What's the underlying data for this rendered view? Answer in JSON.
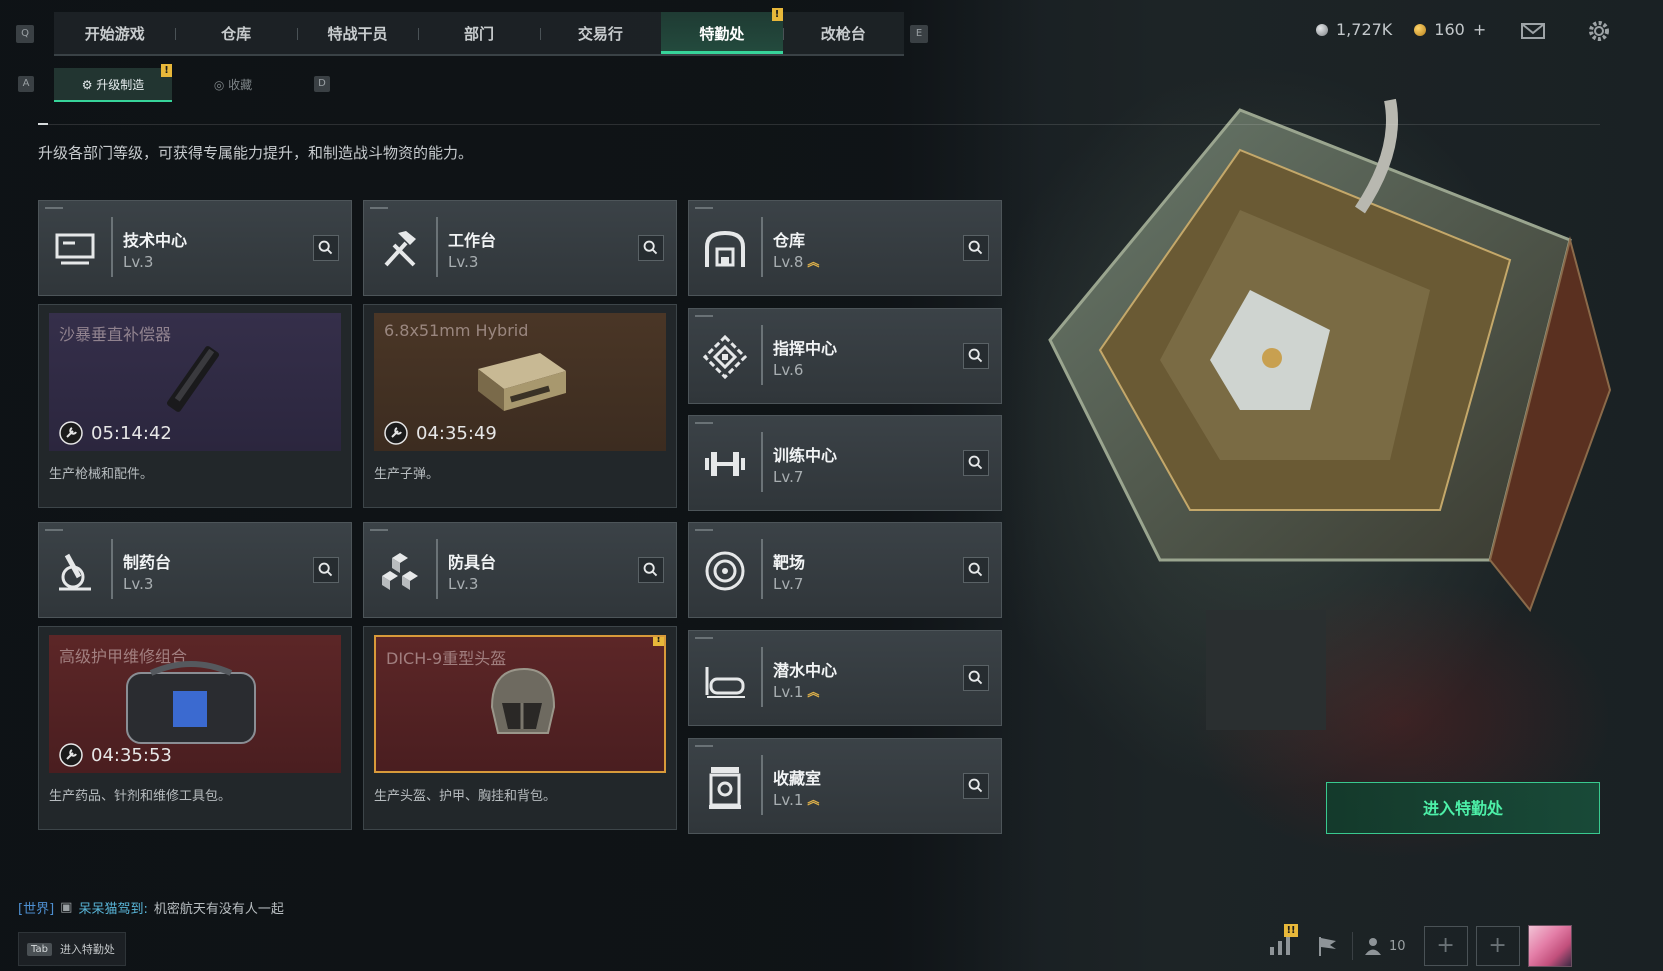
{
  "header": {
    "tabs": [
      {
        "label": "开始游戏"
      },
      {
        "label": "仓库"
      },
      {
        "label": "特战干员"
      },
      {
        "label": "部门"
      },
      {
        "label": "交易行"
      },
      {
        "label": "特勤处",
        "active": true,
        "alert": "!"
      },
      {
        "label": "改枪台"
      }
    ],
    "left_key": "Q",
    "right_key": "E",
    "currency": {
      "silver": "1,727K",
      "gold": "160",
      "add": "+"
    },
    "icons": [
      "mail-icon",
      "gear-icon"
    ]
  },
  "subtabs": {
    "left_key": "A",
    "right_key": "D",
    "items": [
      {
        "label": "升级制造",
        "active": true,
        "alert": "!"
      },
      {
        "label": "收藏",
        "active": false
      }
    ]
  },
  "description": "升级各部门等级，可获得专属能力提升，和制造战斗物资的能力。",
  "departments": [
    {
      "name": "技术中心",
      "level": "Lv.3",
      "icon": "tech-center-icon"
    },
    {
      "name": "工作台",
      "level": "Lv.3",
      "icon": "workbench-icon"
    },
    {
      "name": "仓库",
      "level": "Lv.8",
      "icon": "warehouse-icon",
      "upgradable": true
    },
    {
      "name": "指挥中心",
      "level": "Lv.6",
      "icon": "command-center-icon"
    },
    {
      "name": "训练中心",
      "level": "Lv.7",
      "icon": "training-center-icon"
    },
    {
      "name": "制药台",
      "level": "Lv.3",
      "icon": "pharmacy-icon"
    },
    {
      "name": "防具台",
      "level": "Lv.3",
      "icon": "armor-bench-icon"
    },
    {
      "name": "靶场",
      "level": "Lv.7",
      "icon": "shooting-range-icon"
    },
    {
      "name": "潜水中心",
      "level": "Lv.1",
      "icon": "diving-center-icon",
      "upgradable": true
    },
    {
      "name": "收藏室",
      "level": "Lv.1",
      "icon": "collection-room-icon",
      "upgradable": true
    }
  ],
  "production": [
    {
      "item": "沙暴垂直补偿器",
      "timer": "05:14:42",
      "desc": "生产枪械和配件。",
      "color": "#352f4a"
    },
    {
      "item": "6.8x51mm Hybrid",
      "timer": "04:35:49",
      "desc": "生产子弹。",
      "color": "#4a3626"
    },
    {
      "item": "高级护甲维修组合",
      "timer": "04:35:53",
      "desc": "生产药品、针剂和维修工具包。",
      "color": "#5c2627"
    },
    {
      "item": "DICH-9重型头盔",
      "timer": "",
      "desc": "生产头盔、护甲、胸挂和背包。",
      "color": "#5c2627",
      "alert": "!"
    }
  ],
  "enter_button": "进入特勤处",
  "chat": {
    "channel": "[世界]",
    "user": "呆呆猫驾到:",
    "message": "机密航天有没有人一起"
  },
  "tab_hint": {
    "key": "Tab",
    "label": "进入特勤处"
  },
  "bottom": {
    "players": "10",
    "add_slot": "+",
    "alert": "!!"
  },
  "colors": {
    "accent": "#37d49a",
    "alert": "#e8b83a",
    "upgrade": "#e0b24a"
  }
}
